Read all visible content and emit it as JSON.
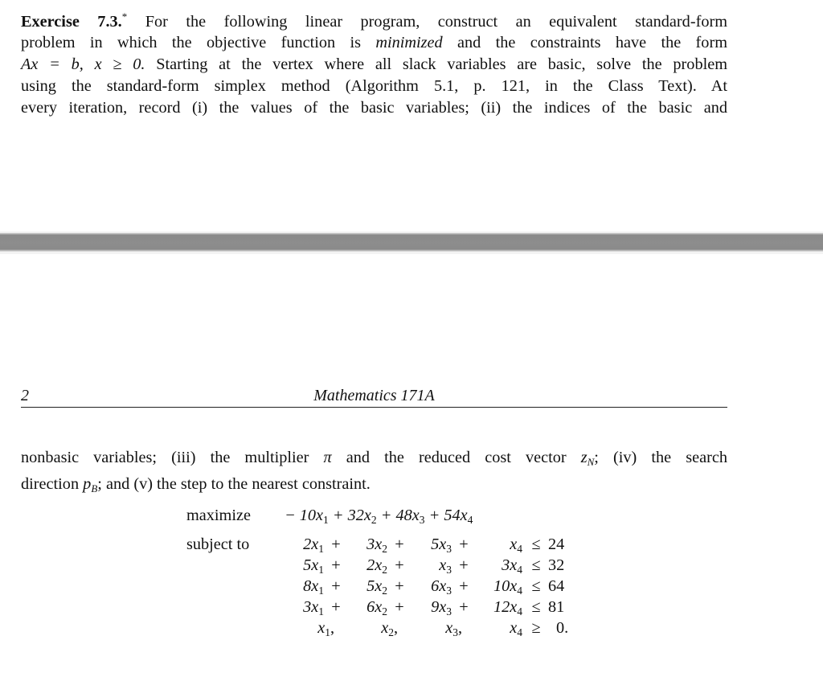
{
  "page_top": {
    "exercise_label": "Exercise 7.3.",
    "exercise_star": "*",
    "lines": [
      "For the following linear program, construct an equivalent standard-form",
      "problem in which the objective function is",
      "minimized",
      "and the constraints have the form",
      "Ax = b, x ≥ 0.",
      "Starting at the vertex where all slack variables are basic, solve the problem",
      "using the standard-form simplex method (Algorithm 5.1, p. 121, in the Class Text).  At",
      "every iteration, record (i) the values of the basic variables; (ii) the indices of the basic and"
    ]
  },
  "running_head": {
    "page_number": "2",
    "course_title": "Mathematics 171A"
  },
  "page_bottom": {
    "line1_a": "nonbasic variables; (iii) the multiplier",
    "pi": "π",
    "line1_b": "and the reduced cost vector",
    "zN_base": "z",
    "zN_sub": "N",
    "line1_c": "; (iv) the search",
    "line2_a": "direction",
    "pB_base": "p",
    "pB_sub": "B",
    "line2_b": "; and (v) the step to the nearest constraint."
  },
  "linear_program": {
    "objective_label": "maximize",
    "constraints_label": "subject to",
    "objective": "− 10x₁ + 32x₂ + 48x₃ + 54x₄",
    "objective_coefficients": [
      -10,
      32,
      48,
      54
    ],
    "constraints": [
      {
        "coefficients": [
          2,
          3,
          5,
          1
        ],
        "terms": [
          "2x",
          "3x",
          "5x",
          "x"
        ],
        "relation": "≤",
        "rhs": "24"
      },
      {
        "coefficients": [
          5,
          2,
          1,
          3
        ],
        "terms": [
          "5x",
          "2x",
          "x",
          "3x"
        ],
        "relation": "≤",
        "rhs": "32"
      },
      {
        "coefficients": [
          8,
          5,
          6,
          10
        ],
        "terms": [
          "8x",
          "5x",
          "6x",
          "10x"
        ],
        "relation": "≤",
        "rhs": "64"
      },
      {
        "coefficients": [
          3,
          6,
          9,
          12
        ],
        "terms": [
          "3x",
          "6x",
          "9x",
          "12x"
        ],
        "relation": "≤",
        "rhs": "81"
      }
    ],
    "nonnegativity": {
      "terms": [
        "x",
        "x",
        "x",
        "x"
      ],
      "separators": [
        ",",
        ",",
        ","
      ],
      "relation": "≥",
      "rhs": "0."
    },
    "subscripts": [
      "1",
      "2",
      "3",
      "4"
    ],
    "plus": "+",
    "obj_terms": [
      "− 10x",
      "+ 32x",
      "+ 48x",
      "+ 54x"
    ]
  }
}
